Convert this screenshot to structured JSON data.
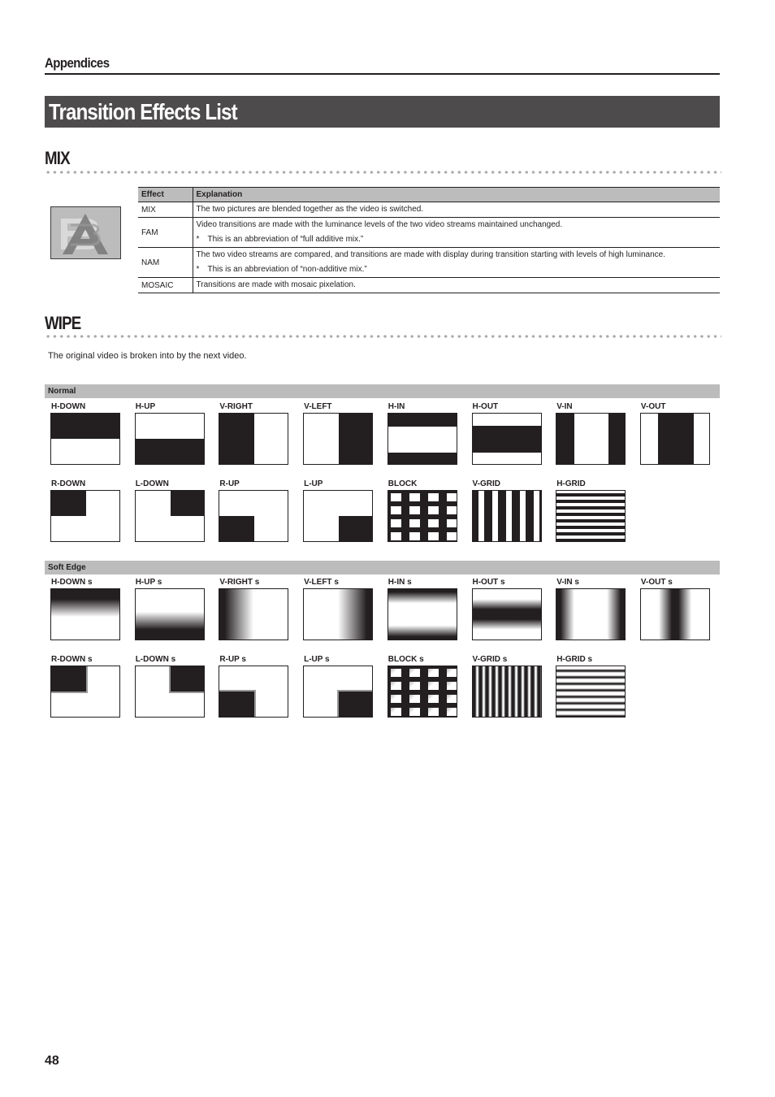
{
  "header": {
    "section": "Appendices"
  },
  "page_title": "Transition Effects List",
  "mix": {
    "heading": "MIX",
    "image_icon": "a-b-mix-icon",
    "table": {
      "columns": [
        "Effect",
        "Explanation"
      ],
      "rows": [
        {
          "effect": "MIX",
          "lines": [
            "The two pictures are blended together as the video is switched."
          ],
          "note": ""
        },
        {
          "effect": "FAM",
          "lines": [
            "Video transitions are made with the luminance levels of the two video streams maintained unchanged."
          ],
          "note": "This is an abbreviation of “full additive mix.”"
        },
        {
          "effect": "NAM",
          "lines": [
            "The two video streams are compared, and transitions are made with display during transition starting with levels of high luminance."
          ],
          "note": "This is an abbreviation of “non-additive mix.”"
        },
        {
          "effect": "MOSAIC",
          "lines": [
            "Transitions are made with mosaic pixelation."
          ],
          "note": ""
        }
      ],
      "note_marker": "*"
    }
  },
  "wipe": {
    "heading": "WIPE",
    "intro": "The original video is broken into by the next video.",
    "groups": [
      {
        "label": "Normal",
        "effects": [
          "H-DOWN",
          "H-UP",
          "V-RIGHT",
          "V-LEFT",
          "H-IN",
          "H-OUT",
          "V-IN",
          "V-OUT",
          "R-DOWN",
          "L-DOWN",
          "R-UP",
          "L-UP",
          "BLOCK",
          "V-GRID",
          "H-GRID"
        ]
      },
      {
        "label": "Soft Edge",
        "effects": [
          "H-DOWN s",
          "H-UP s",
          "V-RIGHT s",
          "V-LEFT s",
          "H-IN s",
          "H-OUT s",
          "V-IN s",
          "V-OUT s",
          "R-DOWN s",
          "L-DOWN s",
          "R-UP s",
          "L-UP s",
          "BLOCK s",
          "V-GRID s",
          "H-GRID s"
        ]
      }
    ]
  },
  "footer": {
    "page_number": "48"
  }
}
